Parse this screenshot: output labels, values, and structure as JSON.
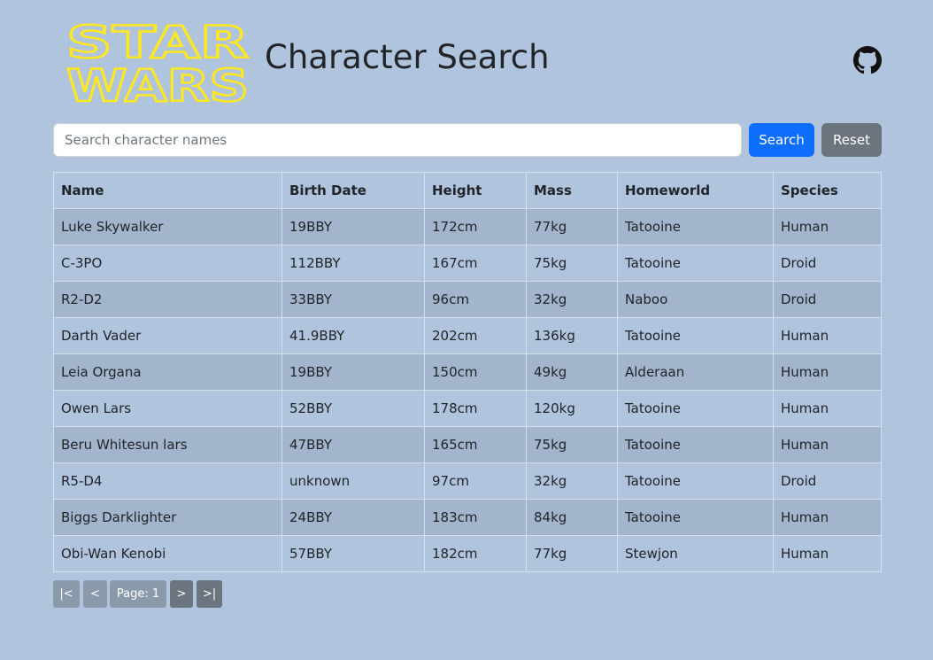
{
  "app": {
    "logo_text": [
      "STAR",
      "WARS"
    ],
    "title": "Character Search"
  },
  "search": {
    "placeholder": "Search character names",
    "value": "",
    "search_label": "Search",
    "reset_label": "Reset"
  },
  "table": {
    "headers": [
      "Name",
      "Birth Date",
      "Height",
      "Mass",
      "Homeworld",
      "Species"
    ],
    "rows": [
      [
        "Luke Skywalker",
        "19BBY",
        "172cm",
        "77kg",
        "Tatooine",
        "Human"
      ],
      [
        "C-3PO",
        "112BBY",
        "167cm",
        "75kg",
        "Tatooine",
        "Droid"
      ],
      [
        "R2-D2",
        "33BBY",
        "96cm",
        "32kg",
        "Naboo",
        "Droid"
      ],
      [
        "Darth Vader",
        "41.9BBY",
        "202cm",
        "136kg",
        "Tatooine",
        "Human"
      ],
      [
        "Leia Organa",
        "19BBY",
        "150cm",
        "49kg",
        "Alderaan",
        "Human"
      ],
      [
        "Owen Lars",
        "52BBY",
        "178cm",
        "120kg",
        "Tatooine",
        "Human"
      ],
      [
        "Beru Whitesun lars",
        "47BBY",
        "165cm",
        "75kg",
        "Tatooine",
        "Human"
      ],
      [
        "R5-D4",
        "unknown",
        "97cm",
        "32kg",
        "Tatooine",
        "Droid"
      ],
      [
        "Biggs Darklighter",
        "24BBY",
        "183cm",
        "84kg",
        "Tatooine",
        "Human"
      ],
      [
        "Obi-Wan Kenobi",
        "57BBY",
        "182cm",
        "77kg",
        "Stewjon",
        "Human"
      ]
    ]
  },
  "pagination": {
    "first_label": "|<",
    "prev_label": "<",
    "page_label": "Page: 1",
    "next_label": ">",
    "last_label": ">|"
  },
  "icons": {
    "github": "github-icon"
  },
  "colors": {
    "background": "#b0c4de",
    "logo_yellow": "#ffe81f",
    "primary": "#0d6efd",
    "secondary": "#6c757d"
  }
}
